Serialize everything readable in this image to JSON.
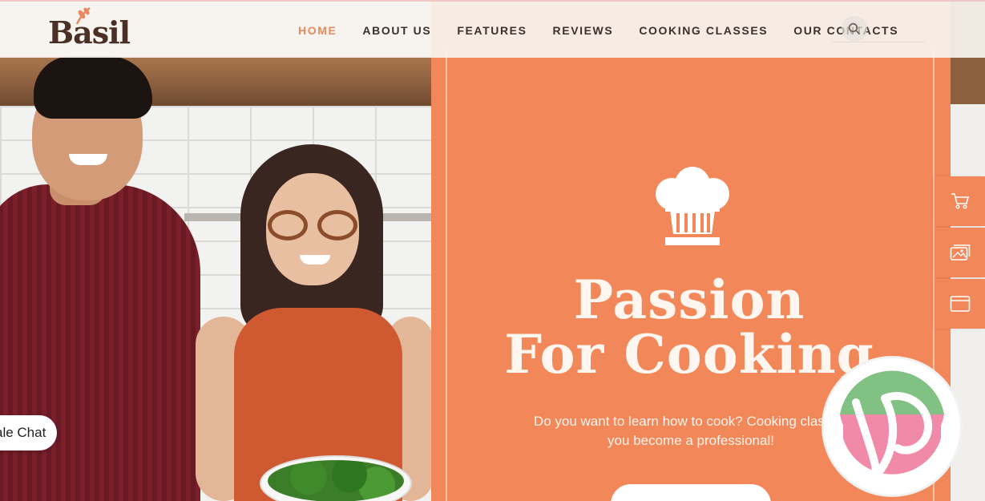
{
  "header": {
    "logo_text": "Basil",
    "nav": [
      {
        "label": "HOME",
        "active": true
      },
      {
        "label": "ABOUT US",
        "active": false
      },
      {
        "label": "FEATURES",
        "active": false
      },
      {
        "label": "REVIEWS",
        "active": false
      },
      {
        "label": "COOKING CLASSES",
        "active": false
      },
      {
        "label": "OUR CONTACTS",
        "active": false
      }
    ],
    "search_icon": "search-icon"
  },
  "hero": {
    "icon": "chef-hat-icon",
    "title_line1": "Passion",
    "title_line2": "For Cooking",
    "subtitle_line1": "Do you want to learn how to cook? Cooking class wi",
    "subtitle_line2": "you become a professional!"
  },
  "side_tools": [
    {
      "icon": "cart-icon"
    },
    {
      "icon": "gallery-icon"
    },
    {
      "icon": "browser-window-icon"
    }
  ],
  "chat": {
    "label": "ale Chat"
  },
  "colors": {
    "accent": "#f2875a",
    "nav_active": "#e9895d",
    "nav_text": "#3b302b",
    "badge_green": "#7fbf7f",
    "badge_pink": "#f08aa8"
  }
}
